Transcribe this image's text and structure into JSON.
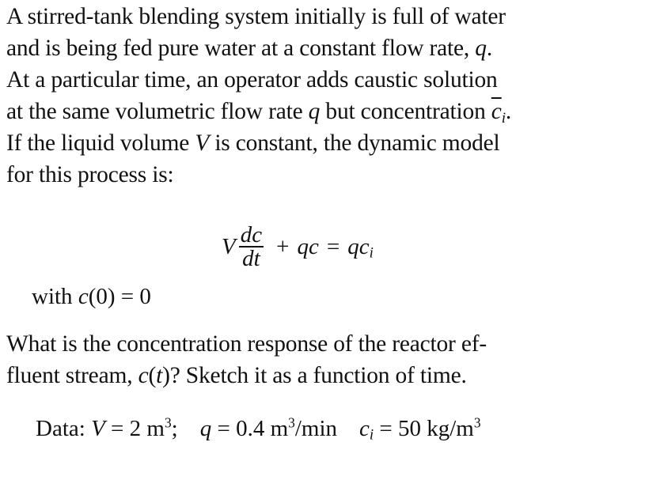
{
  "problem": {
    "intro_lines": [
      "A stirred-tank blending system initially is full of water",
      "and is being fed pure water at a constant flow rate, ",
      "At a particular time, an operator adds caustic solution",
      "at the same volumetric flow rate ",
      "If the liquid volume ",
      "for this process is:"
    ],
    "intro_fragments": {
      "line2_var": "q",
      "line2_end": ".",
      "line4_var": "q",
      "line4_mid": " but concentration ",
      "line4_conc": "c",
      "line4_conc_sub": "i",
      "line4_end": ".",
      "line5_var": "V",
      "line5_end": " is constant, the dynamic model"
    },
    "equation": {
      "lhs_coeff": "V",
      "deriv_num": "dc",
      "deriv_den": "dt",
      "plus": "+",
      "term2": "qc",
      "equals": "=",
      "rhs": "qc",
      "rhs_sub": "i"
    },
    "initial_condition": {
      "prefix": "with ",
      "expr": "c",
      "arg": "(0)",
      "equals": " = 0"
    },
    "question_lines": [
      "What is the concentration response of the reactor ef-",
      "fluent stream, "
    ],
    "question_fragments": {
      "func": "c",
      "arg_open": "(",
      "arg": "t",
      "arg_close": ")",
      "end": "? Sketch it as a function of time."
    },
    "data": {
      "label": "Data: ",
      "V_var": "V",
      "V_eq": " = 2 m",
      "V_exp": "3",
      "V_end": ";",
      "q_var": "q",
      "q_eq": " = 0.4 m",
      "q_exp": "3",
      "q_unit": "/min",
      "ci_var": "c",
      "ci_sub": "i",
      "ci_eq": " = 50 kg/m",
      "ci_exp": "3"
    }
  }
}
